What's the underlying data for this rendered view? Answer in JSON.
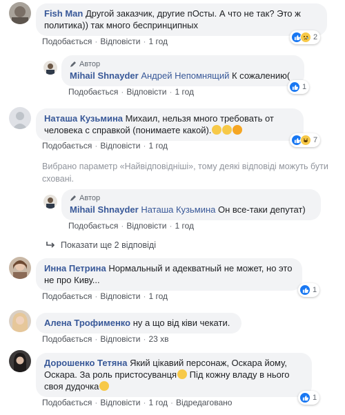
{
  "comments": [
    {
      "name": "Fish Man",
      "text": "Другой заказчик, другие пОсты. А что не так? Это ж политика)) так много беспринципных",
      "like": "Подобається",
      "reply": "Відповісти",
      "time": "1 год",
      "reactions": [
        "like-icon",
        "sad-icon"
      ],
      "count": "2"
    },
    {
      "author_badge": "Автор",
      "name": "Mihail Shnayder",
      "tag": "Андрей Непомнящий",
      "text": "К сожалению(",
      "like": "Подобається",
      "reply": "Відповісти",
      "time": "1 год",
      "reactions": [
        "like-icon"
      ],
      "count": "1"
    },
    {
      "name": "Наташа Кузьмина",
      "text": "Михаил, нельзя много требовать от человека с справкой (понимаете какой).",
      "like": "Подобається",
      "reply": "Відповісти",
      "time": "1 год",
      "reactions": [
        "like-icon",
        "haha-icon"
      ],
      "count": "7"
    },
    {
      "author_badge": "Автор",
      "name": "Mihail Shnayder",
      "tag": "Наташа Кузьмина",
      "text": "Он все-таки депутат)",
      "like": "Подобається",
      "reply": "Відповісти",
      "time": "1 год"
    },
    {
      "name": "Инна Петрина",
      "text": "Нормальный и адекватный не может, но это не про Киву...",
      "like": "Подобається",
      "reply": "Відповісти",
      "time": "1 год",
      "reactions": [
        "like-icon"
      ],
      "count": "1"
    },
    {
      "name": "Алена Трофименко",
      "text": "ну а що від ківи чекати.",
      "like": "Подобається",
      "reply": "Відповісти",
      "time": "23 хв"
    },
    {
      "name": "Дорошенко Тетяна",
      "text1": "Який цікавий персонаж, Оскара йому, Оскара. За роль пристосуванця",
      "text2": " Під кожну владу в нього своя дудочка",
      "like": "Подобається",
      "reply": "Відповісти",
      "time": "1 год",
      "edited": "Відредаговано",
      "reactions": [
        "like-icon"
      ],
      "count": "1"
    }
  ],
  "notice": "Вибрано параметр «Найвідповідніші», тому деякі відповіді можуть бути сховані.",
  "show_more": "Показати ще 2 відповіді",
  "colors": {
    "link": "#385898",
    "like": "#1877f2",
    "bubble": "#f2f3f5",
    "muted": "#90949c"
  }
}
